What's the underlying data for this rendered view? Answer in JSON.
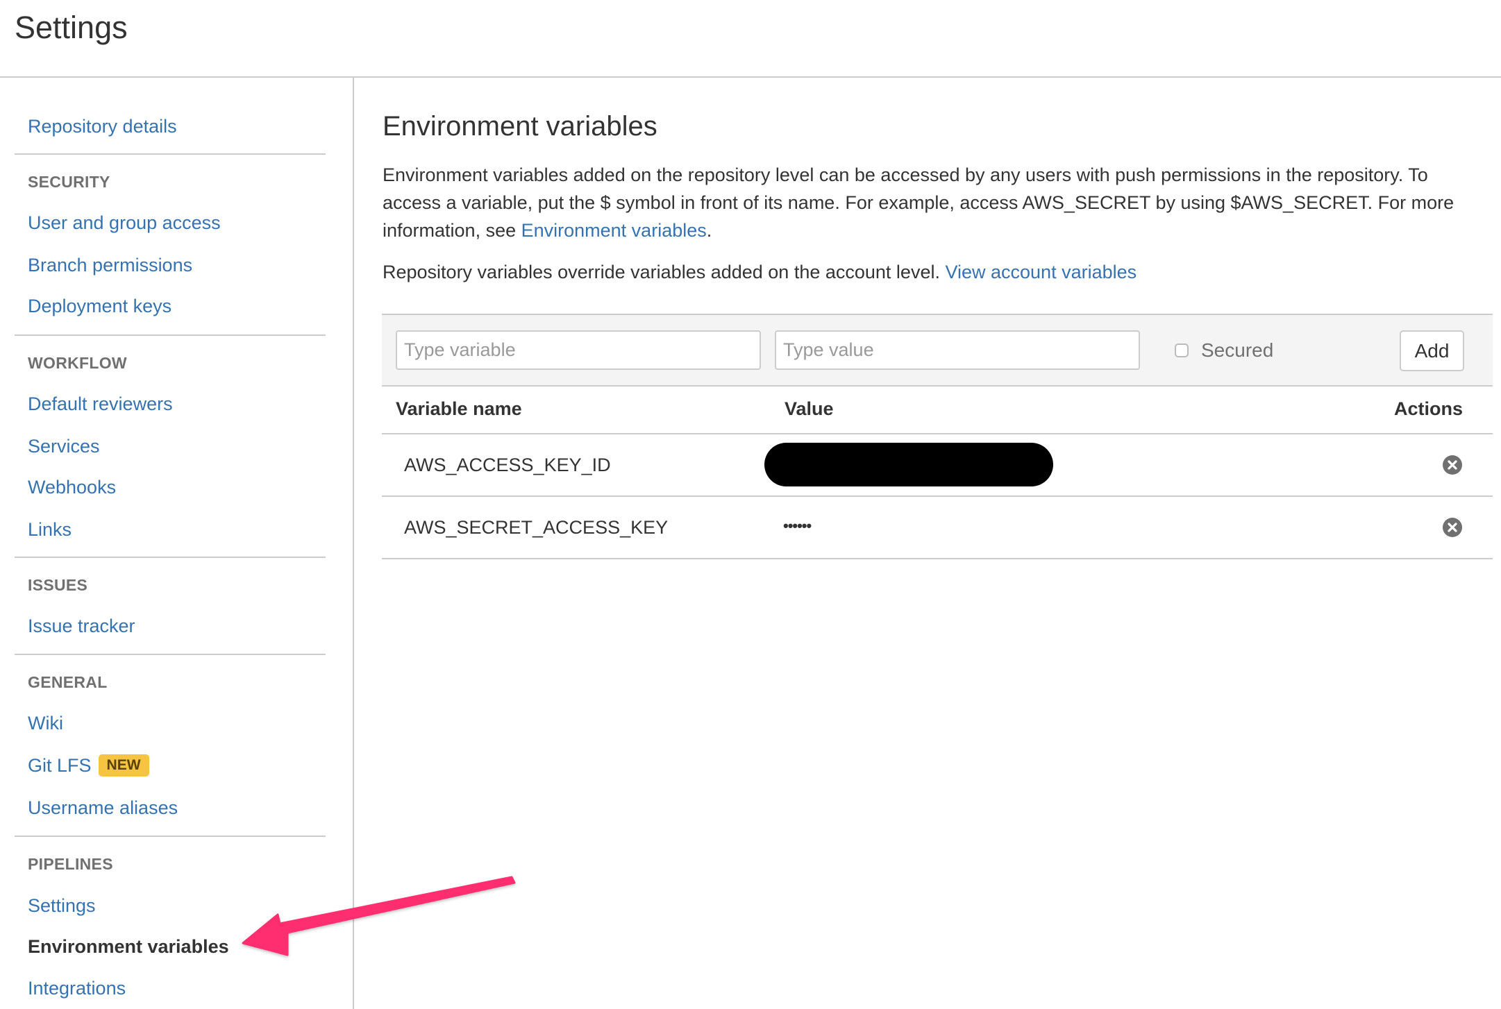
{
  "header": {
    "title": "Settings"
  },
  "sidebar": {
    "top_link": "Repository details",
    "sections": [
      {
        "heading": "SECURITY",
        "items": [
          "User and group access",
          "Branch permissions",
          "Deployment keys"
        ]
      },
      {
        "heading": "WORKFLOW",
        "items": [
          "Default reviewers",
          "Services",
          "Webhooks",
          "Links"
        ]
      },
      {
        "heading": "ISSUES",
        "items": [
          "Issue tracker"
        ]
      },
      {
        "heading": "GENERAL",
        "items": [
          "Wiki",
          "Git LFS",
          "Username aliases"
        ],
        "badge": {
          "item": "Git LFS",
          "label": "NEW"
        }
      },
      {
        "heading": "PIPELINES",
        "items": [
          "Settings",
          "Environment variables",
          "Integrations"
        ],
        "active": "Environment variables"
      }
    ]
  },
  "main": {
    "title": "Environment variables",
    "description_text": "Environment variables added on the repository level can be accessed by any users with push permissions in the repository. To access a variable, put the $ symbol in front of its name. For example, access AWS_SECRET by using $AWS_SECRET. For more information, see ",
    "description_link": "Environment variables",
    "description_end": ".",
    "override_text": "Repository variables override variables added on the account level. ",
    "override_link": "View account variables",
    "form": {
      "variable_placeholder": "Type variable",
      "value_placeholder": "Type value",
      "variable_value": "",
      "value_value": "",
      "secured_label": "Secured",
      "secured_checked": false,
      "add_label": "Add"
    },
    "table": {
      "columns": [
        "Variable name",
        "Value",
        "Actions"
      ],
      "rows": [
        {
          "name": "AWS_ACCESS_KEY_ID",
          "value": "[redacted]",
          "redacted": true
        },
        {
          "name": "AWS_SECRET_ACCESS_KEY",
          "value": "••••••",
          "redacted": false
        }
      ]
    }
  },
  "annotation": {
    "type": "arrow",
    "color": "#ff2d6f",
    "points_to": "Environment variables"
  },
  "colors": {
    "link": "#3572b0",
    "text": "#333333",
    "heading_muted": "#707070",
    "border": "#cccccc",
    "form_bg": "#f4f4f4",
    "badge_bg": "#f6c342",
    "badge_text": "#594300",
    "delete_icon": "#707070"
  }
}
